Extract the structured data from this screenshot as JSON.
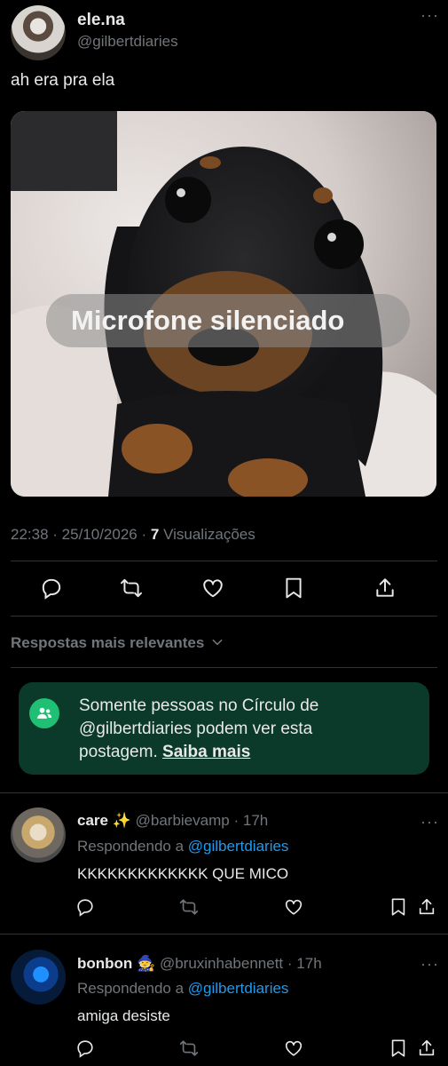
{
  "tweet": {
    "author_name": "ele.na",
    "author_handle": "@gilbertdiaries",
    "text": "ah era pra ela",
    "image_caption": "Microfone silenciado",
    "time": "22:38",
    "date": "25/10/2026",
    "views_count": "7",
    "views_label": "Visualizações"
  },
  "replies_filter": {
    "label": "Respostas mais relevantes"
  },
  "circle_notice": {
    "line1": "Somente pessoas no Círculo de",
    "line2": "@gilbertdiaries podem ver esta",
    "line3": "postagem.",
    "link": "Saiba mais",
    "bg_color": "#0b3a2b",
    "icon_color": "#1fbf74"
  },
  "replies": [
    {
      "name": "care",
      "emoji": "✨",
      "handle": "@barbievamp",
      "time": "17h",
      "replying_prefix": "Respondendo a",
      "replying_to": "@gilbertdiaries",
      "text": "KKKKKKKKKKKKK QUE MICO"
    },
    {
      "name": "bonbon",
      "emoji": "🧙",
      "handle": "@bruxinhabennett",
      "time": "17h",
      "replying_prefix": "Respondendo a",
      "replying_to": "@gilbertdiaries",
      "text": "amiga desiste"
    }
  ],
  "colors": {
    "background": "#000000",
    "text": "#e7e9ea",
    "muted": "#71767b",
    "link": "#1d9bf0",
    "divider": "#2f3336"
  }
}
